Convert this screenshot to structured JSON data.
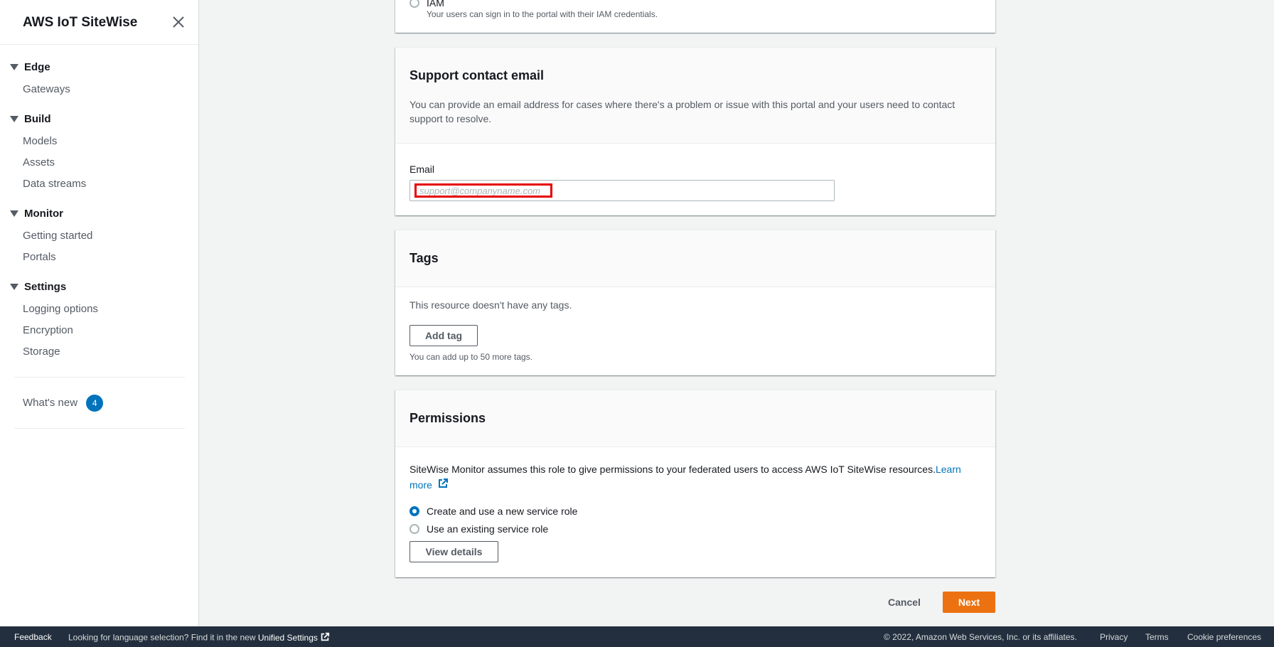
{
  "sidebar": {
    "title": "AWS IoT SiteWise",
    "sections": [
      {
        "label": "Edge",
        "items": [
          "Gateways"
        ]
      },
      {
        "label": "Build",
        "items": [
          "Models",
          "Assets",
          "Data streams"
        ]
      },
      {
        "label": "Monitor",
        "items": [
          "Getting started",
          "Portals"
        ]
      },
      {
        "label": "Settings",
        "items": [
          "Logging options",
          "Encryption",
          "Storage"
        ]
      }
    ],
    "whats_new": {
      "label": "What's new",
      "count": "4"
    }
  },
  "auth_panel": {
    "option_label": "IAM",
    "option_desc": "Your users can sign in to the portal with their IAM credentials."
  },
  "support_panel": {
    "title": "Support contact email",
    "description": "You can provide an email address for cases where there's a problem or issue with this portal and your users need to contact support to resolve.",
    "email_label": "Email",
    "email_placeholder": "support@companyname.com",
    "email_value": ""
  },
  "tags_panel": {
    "title": "Tags",
    "empty_text": "This resource doesn't have any tags.",
    "add_button": "Add tag",
    "limit_note": "You can add up to 50 more tags."
  },
  "permissions_panel": {
    "title": "Permissions",
    "description": "SiteWise Monitor assumes this role to give permissions to your federated users to access AWS IoT SiteWise resources.",
    "learn_more": "Learn more",
    "options": [
      {
        "label": "Create and use a new service role",
        "checked": true
      },
      {
        "label": "Use an existing service role",
        "checked": false
      }
    ],
    "view_details": "View details"
  },
  "actions": {
    "cancel": "Cancel",
    "next": "Next"
  },
  "bottom_bar": {
    "feedback": "Feedback",
    "language_text": "Looking for language selection? Find it in the new",
    "unified_settings": "Unified Settings",
    "copyright": "© 2022, Amazon Web Services, Inc. or its affiliates.",
    "privacy": "Privacy",
    "terms": "Terms",
    "cookie": "Cookie preferences"
  },
  "colors": {
    "accent": "#0073bb",
    "primary_button": "#ec7211",
    "footer_bg": "#232f3e",
    "highlight": "#e60000"
  }
}
